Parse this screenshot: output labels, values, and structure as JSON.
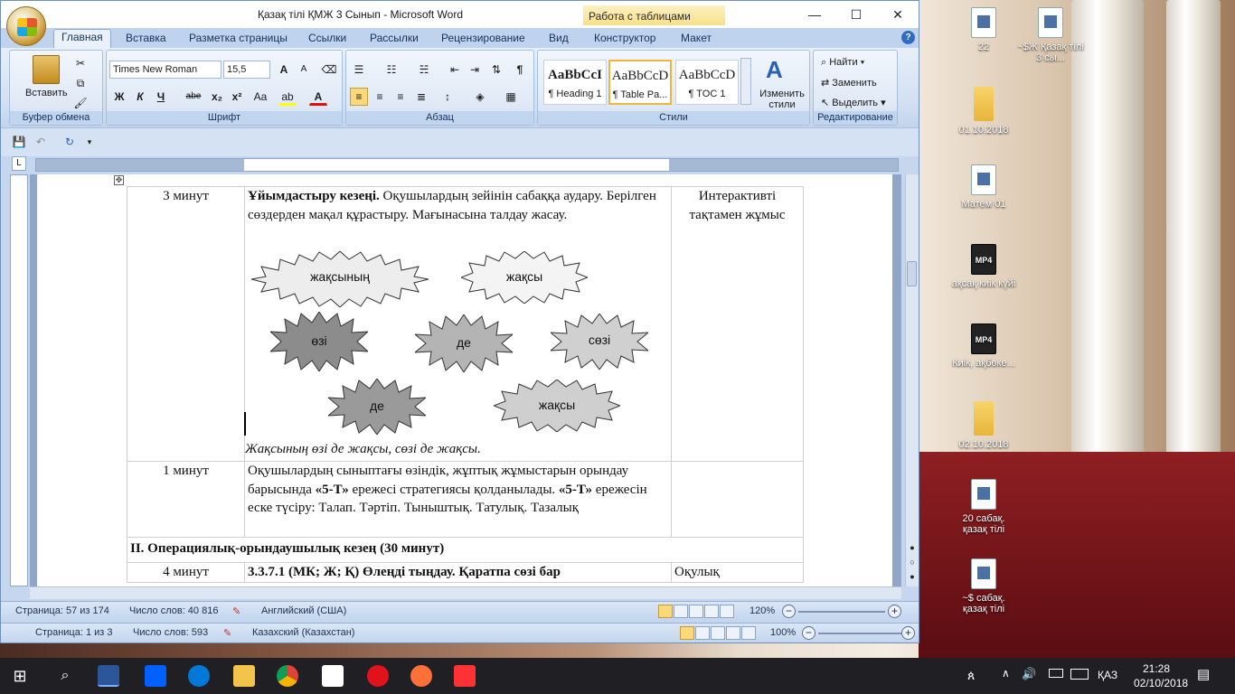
{
  "window": {
    "title": "Қазақ тілі ҚМЖ 3 Сынып  -  Microsoft Word",
    "context_tab": "Работа с таблицами",
    "controls": {
      "minimize": "—",
      "maximize": "☐",
      "close": "✕"
    }
  },
  "tabs": [
    "Главная",
    "Вставка",
    "Разметка страницы",
    "Ссылки",
    "Рассылки",
    "Рецензирование",
    "Вид",
    "Конструктор",
    "Макет"
  ],
  "ribbon": {
    "clipboard": {
      "label": "Буфер обмена",
      "paste": "Вставить"
    },
    "font": {
      "label": "Шрифт",
      "family": "Times New Roman",
      "size": "15,5",
      "bold": "Ж",
      "italic": "К",
      "underline": "Ч",
      "strike": "abe",
      "sub": "x₂",
      "sup": "x²",
      "case": "Aa",
      "grow": "A",
      "shrink": "A"
    },
    "paragraph": {
      "label": "Абзац",
      "show_marks": "¶"
    },
    "styles": {
      "label": "Стили",
      "items": [
        {
          "sample": "AaBbCcI",
          "name": "¶ Heading 1"
        },
        {
          "sample": "AaBbCcD",
          "name": "¶ Table Pa..."
        },
        {
          "sample": "AaBbCcD",
          "name": "¶ TOC 1"
        }
      ],
      "change": "Изменить стили"
    },
    "editing": {
      "label": "Редактирование",
      "find": "Найти",
      "replace": "Заменить",
      "select": "Выделить"
    }
  },
  "document": {
    "rows": [
      {
        "time": "3 минут",
        "bold_lead": "Ұйымдастыру кезеңі.",
        "text": " Оқушылардың зейінін сабаққа аудару. Берілген сөздерден мақал құрастыру. Мағынасына талдау жасау.",
        "resource": "Интерактивті тақтамен жұмыс"
      },
      {
        "time": "1 минут",
        "text": "Оқушылардың сыныптағы өзіндік, жұптық жұмыстарын орындау барысында ",
        "b1": "«5-Т»",
        "text2": " ережесі стратегиясы қолданылады. ",
        "b2": "«5-Т»",
        "text3": " ережесін еске түсіру: Талап. Тәртіп. Тыныштық. Татулық. Тазалық",
        "resource": ""
      },
      {
        "section": "II.  Операциялық-орындаушылық кезең (30 минут)"
      },
      {
        "time": "4 минут",
        "bold_lead": "3.3.7.1 (МК; Ж; Қ) Өлеңді тыңдау. Қаратпа сөзі бар",
        "resource": "Оқулық"
      }
    ],
    "bursts": [
      "жақсының",
      "жақсы",
      "өзі",
      "де",
      "сөзі",
      "де",
      "жақсы"
    ],
    "proverb": "Жақсының өзі де жақсы, сөзі де жақсы."
  },
  "status1": {
    "page": "Страница: 57 из 174",
    "words": "Число слов: 40 816",
    "lang": "Английский (США)",
    "zoom": "120%"
  },
  "status2": {
    "page": "Страница: 1 из 3",
    "words": "Число слов: 593",
    "lang": "Казахский (Казахстан)",
    "zoom": "100%"
  },
  "desktop_icons": [
    {
      "label": "22",
      "type": "doc"
    },
    {
      "label": "~$Ж  Қазақ тілі  3 сы...",
      "type": "doc"
    },
    {
      "label": "01.10.2018",
      "type": "folder"
    },
    {
      "label": "Матем 01",
      "type": "doc"
    },
    {
      "label": "ақсақ киік күйі",
      "type": "mp4"
    },
    {
      "label": "Киік, ақбөке...",
      "type": "mp4"
    },
    {
      "label": "02.10.2018",
      "type": "folder"
    },
    {
      "label": "20 сабақ. қазақ тілі",
      "type": "doc"
    },
    {
      "label": "~$ сабақ. қазақ тілі",
      "type": "doc"
    }
  ],
  "taskbar": {
    "lang": "ҚАЗ",
    "time": "21:28",
    "date": "02/10/2018"
  }
}
